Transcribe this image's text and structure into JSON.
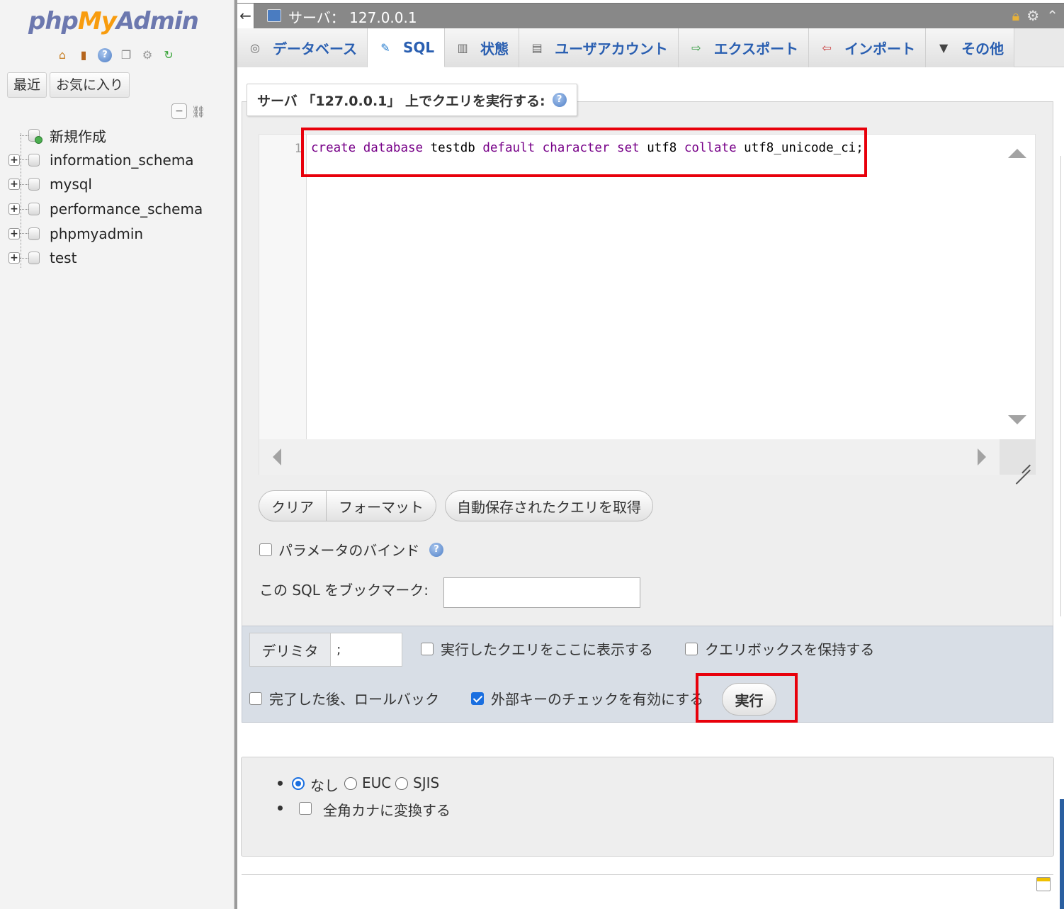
{
  "nav": {
    "logo": {
      "php": "php",
      "my": "My",
      "admin": "Admin"
    },
    "tabs": [
      "最近",
      "お気に入り"
    ],
    "tree": [
      {
        "label": "新規作成",
        "type": "new"
      },
      {
        "label": "information_schema",
        "type": "db"
      },
      {
        "label": "mysql",
        "type": "db"
      },
      {
        "label": "performance_schema",
        "type": "db"
      },
      {
        "label": "phpmyadmin",
        "type": "db"
      },
      {
        "label": "test",
        "type": "db"
      }
    ]
  },
  "topbar": {
    "title": "サーバ： 127.0.0.1",
    "back_glyph": "←"
  },
  "tabs": [
    {
      "label": "データベース",
      "icon": "database-icon"
    },
    {
      "label": "SQL",
      "icon": "sql-icon",
      "active": true
    },
    {
      "label": "状態",
      "icon": "status-icon"
    },
    {
      "label": "ユーザアカウント",
      "icon": "users-icon"
    },
    {
      "label": "エクスポート",
      "icon": "export-icon"
    },
    {
      "label": "インポート",
      "icon": "import-icon"
    },
    {
      "label": "その他",
      "icon": "more-icon"
    }
  ],
  "sql": {
    "legend": "サーバ 「127.0.0.1」 上でクエリを実行する:",
    "line_number": "1",
    "query_tokens": [
      {
        "t": "create",
        "kw": true
      },
      {
        "t": " "
      },
      {
        "t": "database",
        "kw": true
      },
      {
        "t": " testdb "
      },
      {
        "t": "default",
        "kw": true
      },
      {
        "t": " "
      },
      {
        "t": "character",
        "kw": true
      },
      {
        "t": " "
      },
      {
        "t": "set",
        "kw": true
      },
      {
        "t": " utf8 "
      },
      {
        "t": "collate",
        "kw": true
      },
      {
        "t": " utf8_unicode_ci;"
      }
    ],
    "buttons": {
      "clear": "クリア",
      "format": "フォーマット",
      "autoload": "自動保存されたクエリを取得"
    },
    "bind_params_label": "パラメータのバインド",
    "bookmark_label": "この SQL をブックマーク:",
    "bookmark_value": ""
  },
  "options": {
    "delimiter_label": "デリミタ",
    "delimiter_value": ";",
    "show_query_label": "実行したクエリをここに表示する",
    "retain_box_label": "クエリボックスを保持する",
    "rollback_label": "完了した後、ロールバック",
    "fk_check_label": "外部キーのチェックを有効にする",
    "fk_check_checked": true,
    "go_label": "実行"
  },
  "encoding": {
    "options": [
      "なし",
      "EUC",
      "SJIS"
    ],
    "selected": "なし",
    "kana_label": "全角カナに変換する"
  },
  "colors": {
    "highlight": "#e8000b",
    "link": "#2a5fb1",
    "keyword": "#770088"
  }
}
